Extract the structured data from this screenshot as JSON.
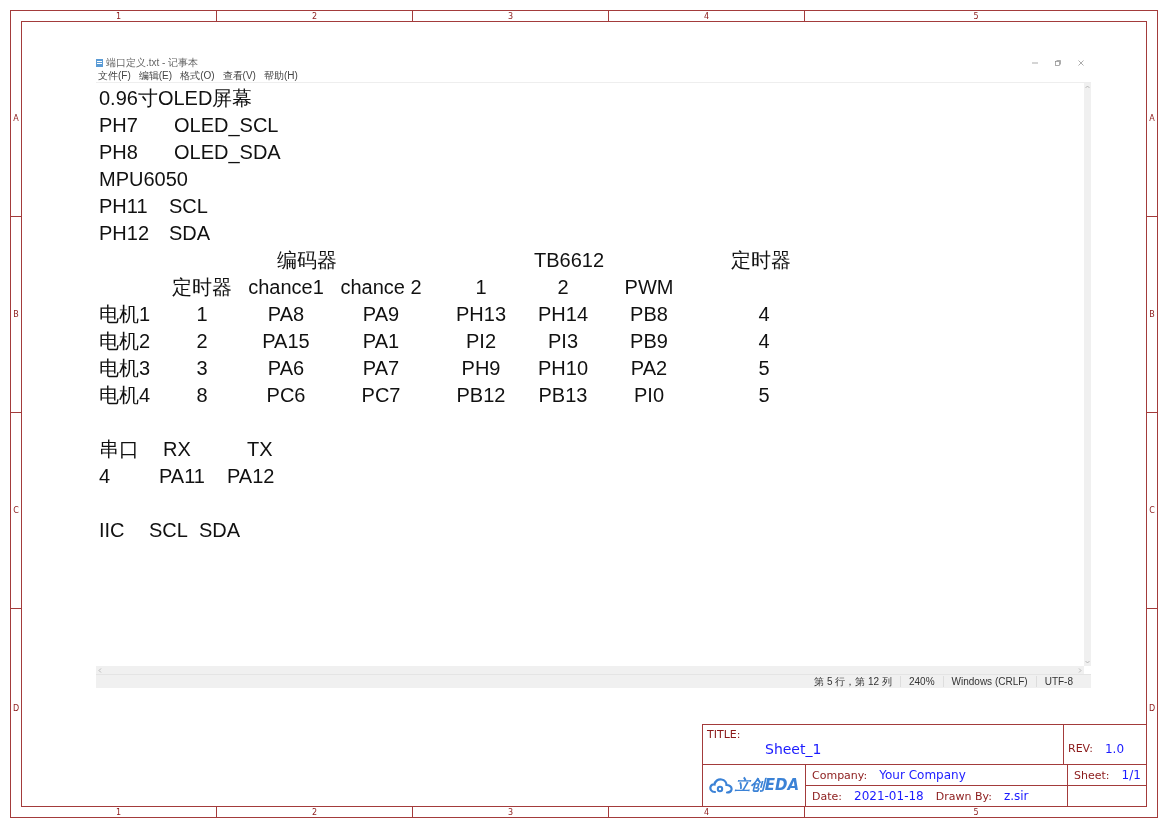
{
  "frame": {
    "top_columns": [
      "1",
      "2",
      "3",
      "4",
      "5"
    ],
    "bottom_columns": [
      "1",
      "2",
      "3",
      "4",
      "5"
    ],
    "left_rows": [
      "A",
      "B",
      "C",
      "D"
    ],
    "right_rows": [
      "A",
      "B",
      "C",
      "D"
    ]
  },
  "notepad": {
    "title": "端口定义.txt - 记事本",
    "menu": [
      "文件(F)",
      "编辑(E)",
      "格式(O)",
      "查看(V)",
      "帮助(H)"
    ],
    "lines": [
      {
        "kind": "text",
        "cells": [
          "0.96寸OLED屏幕"
        ]
      },
      {
        "kind": "pair",
        "cells": [
          "PH7",
          "OLED_SCL"
        ]
      },
      {
        "kind": "pair",
        "cells": [
          "PH8",
          "OLED_SDA"
        ]
      },
      {
        "kind": "text",
        "cells": [
          "MPU6050"
        ]
      },
      {
        "kind": "pair",
        "cells": [
          "PH11",
          "SCL"
        ]
      },
      {
        "kind": "pair",
        "cells": [
          "PH12",
          "SDA"
        ]
      },
      {
        "kind": "group",
        "cells": [
          "编码器",
          "TB6612",
          "定时器"
        ]
      },
      {
        "kind": "row",
        "cells": [
          "",
          "定时器",
          "chance1",
          "chance 2",
          "1",
          "2",
          "PWM",
          ""
        ]
      },
      {
        "kind": "row",
        "cells": [
          "电机1",
          "1",
          "PA8",
          "PA9",
          "PH13",
          "PH14",
          "PB8",
          "4"
        ]
      },
      {
        "kind": "row",
        "cells": [
          "电机2",
          "2",
          "PA15",
          "PA1",
          "PI2",
          "PI3",
          "PB9",
          "4"
        ]
      },
      {
        "kind": "row",
        "cells": [
          "电机3",
          "3",
          "PA6",
          "PA7",
          "PH9",
          "PH10",
          "PA2",
          "5"
        ]
      },
      {
        "kind": "row",
        "cells": [
          "电机4",
          "8",
          "PC6",
          "PC7",
          "PB12",
          "PB13",
          "PI0",
          "5"
        ]
      },
      {
        "kind": "serial",
        "cells": [
          "串口",
          "RX",
          "TX"
        ]
      },
      {
        "kind": "serial2",
        "cells": [
          "4",
          "PA11",
          "PA12"
        ]
      },
      {
        "kind": "iic",
        "cells": [
          "IIC",
          "SCL",
          "SDA"
        ]
      }
    ],
    "status": [
      "第 5 行，第 12 列",
      "240%",
      "Windows (CRLF)",
      "UTF-8"
    ]
  },
  "title_block": {
    "title_label": "TITLE:",
    "title": "Sheet_1",
    "rev_label": "REV:",
    "rev": "1.0",
    "logo": "立创EDA",
    "company_label": "Company:",
    "company": "Your Company",
    "sheet_label": "Sheet:",
    "sheet": "1/1",
    "date_label": "Date:",
    "date": "2021-01-18",
    "drawn_label": "Drawn By:",
    "drawn": "z.sir"
  }
}
